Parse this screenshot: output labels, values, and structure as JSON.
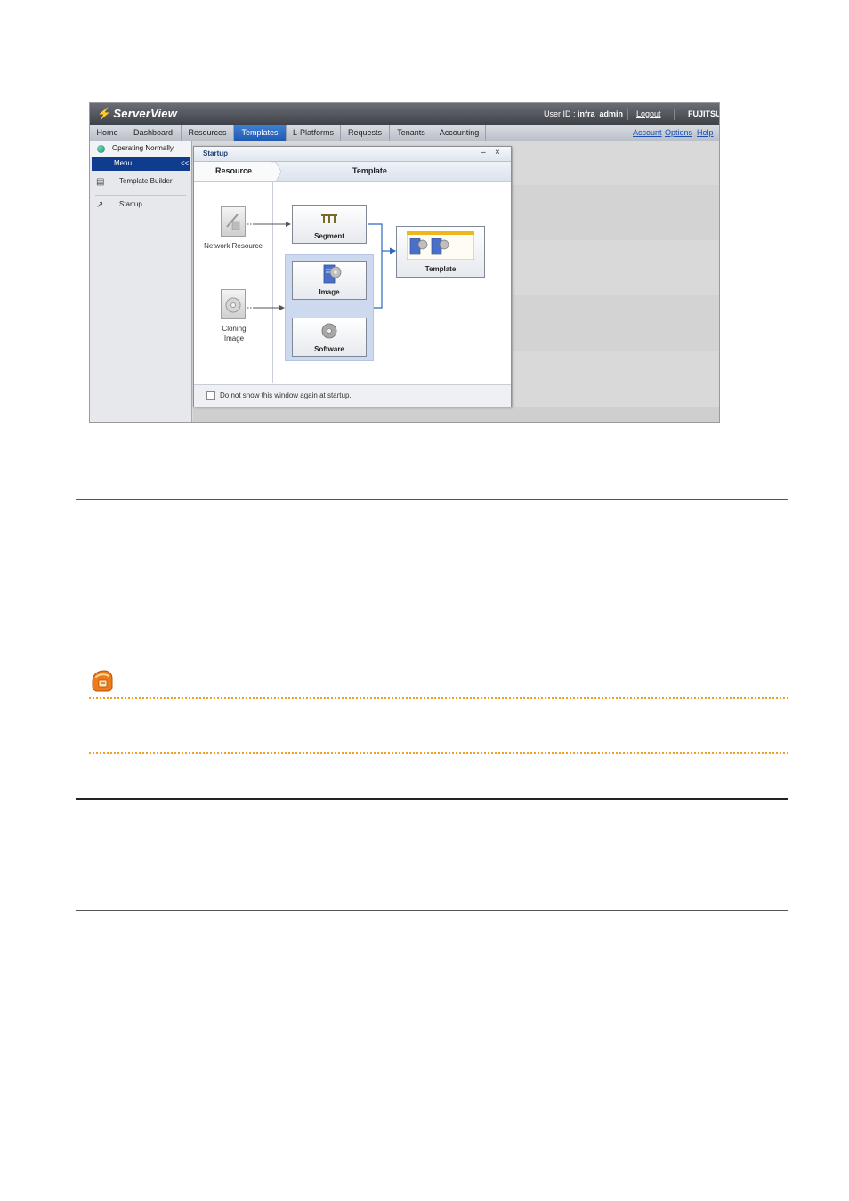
{
  "header": {
    "logo": "ServerView",
    "userid_label": "User ID :",
    "userid_value": "infra_admin",
    "logout": "Logout",
    "brand": "FUJITSU"
  },
  "tabs": [
    "Home",
    "Dashboard",
    "Resources",
    "Templates",
    "L-Platforms",
    "Requests",
    "Tenants",
    "Accounting"
  ],
  "active_tab": "Templates",
  "top_links": [
    "Account",
    "Options",
    "Help"
  ],
  "left": {
    "status": "Operating Normally",
    "menu": "Menu",
    "collapse": "<<",
    "items": [
      "Template Builder",
      "Startup"
    ]
  },
  "dialog": {
    "title": "Startup",
    "header_left": "Resource",
    "header_right": "Template",
    "network_resource": "Network Resource",
    "cloning_image": "Cloning Image",
    "segment": "Segment",
    "image": "Image",
    "software": "Software",
    "template": "Template",
    "footer": "Do not show this window again at startup."
  },
  "colors": {
    "active_tab": "#2a68c2",
    "menu_header": "#0f3c8e",
    "flow_arrow": "#2a68c2",
    "note_dots": "#f0a020"
  }
}
